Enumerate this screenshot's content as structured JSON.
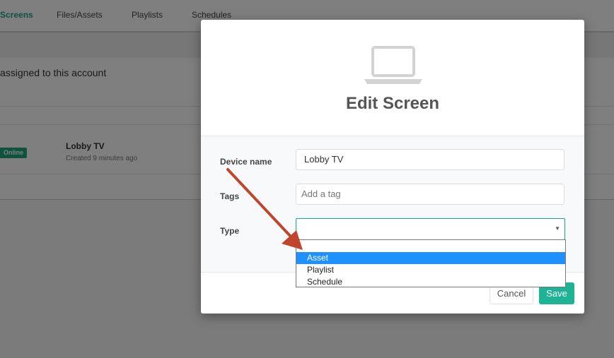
{
  "nav": {
    "tabs": [
      "Screens",
      "Files/Assets",
      "Playlists",
      "Schedules"
    ]
  },
  "background": {
    "assigned_text": "assigned to this account",
    "status_badge": "Online",
    "screen_name": "Lobby TV",
    "screen_created": "Created 9 minutes ago"
  },
  "modal": {
    "icon": "laptop-icon",
    "title": "Edit Screen",
    "fields": {
      "device_name_label": "Device name",
      "device_name_value": "Lobby TV",
      "tags_label": "Tags",
      "tags_placeholder": "Add a tag",
      "type_label": "Type",
      "type_value": ""
    },
    "type_options": [
      "Asset",
      "Playlist",
      "Schedule"
    ],
    "selected_option": "Asset",
    "cancel_label": "Cancel",
    "save_label": "Save"
  },
  "colors": {
    "accent": "#17a589",
    "save_button": "#1db394",
    "highlight": "#1e90ff",
    "annotation_arrow": "#c0442e"
  }
}
